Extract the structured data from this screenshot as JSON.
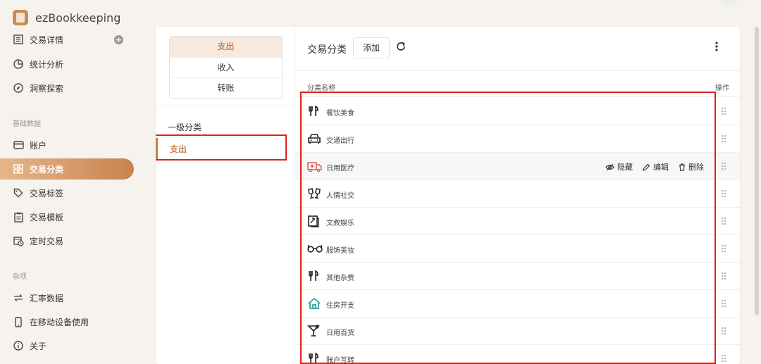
{
  "app": {
    "name": "ezBookkeeping"
  },
  "sidebar": {
    "items": [
      {
        "label": "交易详情",
        "icon": "list-icon"
      },
      {
        "label": "统计分析",
        "icon": "chart-pie-icon"
      },
      {
        "label": "洞察探索",
        "icon": "compass-icon"
      }
    ],
    "sections": [
      {
        "label": "基础数据"
      },
      {
        "label": "杂项"
      }
    ],
    "base_items": [
      {
        "label": "账户",
        "icon": "credit-card-icon"
      },
      {
        "label": "交易分类",
        "icon": "grid-icon"
      },
      {
        "label": "交易标签",
        "icon": "tag-icon"
      },
      {
        "label": "交易模板",
        "icon": "clipboard-icon"
      },
      {
        "label": "定时交易",
        "icon": "calendar-clock-icon"
      }
    ],
    "misc_items": [
      {
        "label": "汇率数据",
        "icon": "swap-icon"
      },
      {
        "label": "在移动设备使用",
        "icon": "phone-icon"
      },
      {
        "label": "关于",
        "icon": "info-icon"
      }
    ],
    "plus": "+"
  },
  "type_tabs": [
    "支出",
    "收入",
    "转账"
  ],
  "level": {
    "label": "一级分类",
    "item": "支出"
  },
  "main": {
    "title": "交易分类",
    "add_label": "添加",
    "col_name": "分类名称",
    "col_op": "操作",
    "actions": {
      "hide": "隐藏",
      "edit": "编辑",
      "delete": "删除"
    },
    "rows": [
      {
        "name": "餐饮美食",
        "icon": "fork-knife-icon"
      },
      {
        "name": "交通出行",
        "icon": "car-icon"
      },
      {
        "name": "日用医疗",
        "icon": "ambulance-icon"
      },
      {
        "name": "人情社交",
        "icon": "cheers-icon"
      },
      {
        "name": "文教娱乐",
        "icon": "book-icon"
      },
      {
        "name": "服饰美妆",
        "icon": "glasses-icon"
      },
      {
        "name": "其他杂费",
        "icon": "fork-knife-icon"
      },
      {
        "name": "住房开支",
        "icon": "house-icon"
      },
      {
        "name": "日用百货",
        "icon": "cocktail-icon"
      },
      {
        "name": "账户互转",
        "icon": "fork-knife-icon"
      }
    ]
  },
  "colors": {
    "accent": "#c8834f",
    "highlight": "#e02020",
    "house_icon": "#2aa198",
    "ambulance_icon": "#e05555"
  }
}
